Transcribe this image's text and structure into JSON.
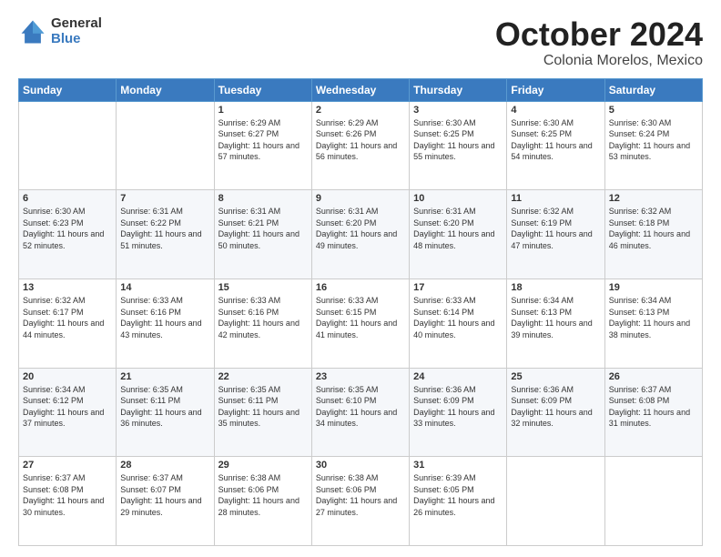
{
  "logo": {
    "general": "General",
    "blue": "Blue"
  },
  "title": {
    "month": "October 2024",
    "location": "Colonia Morelos, Mexico"
  },
  "weekdays": [
    "Sunday",
    "Monday",
    "Tuesday",
    "Wednesday",
    "Thursday",
    "Friday",
    "Saturday"
  ],
  "weeks": [
    [
      {
        "day": "",
        "sunrise": "",
        "sunset": "",
        "daylight": ""
      },
      {
        "day": "",
        "sunrise": "",
        "sunset": "",
        "daylight": ""
      },
      {
        "day": "1",
        "sunrise": "Sunrise: 6:29 AM",
        "sunset": "Sunset: 6:27 PM",
        "daylight": "Daylight: 11 hours and 57 minutes."
      },
      {
        "day": "2",
        "sunrise": "Sunrise: 6:29 AM",
        "sunset": "Sunset: 6:26 PM",
        "daylight": "Daylight: 11 hours and 56 minutes."
      },
      {
        "day": "3",
        "sunrise": "Sunrise: 6:30 AM",
        "sunset": "Sunset: 6:25 PM",
        "daylight": "Daylight: 11 hours and 55 minutes."
      },
      {
        "day": "4",
        "sunrise": "Sunrise: 6:30 AM",
        "sunset": "Sunset: 6:25 PM",
        "daylight": "Daylight: 11 hours and 54 minutes."
      },
      {
        "day": "5",
        "sunrise": "Sunrise: 6:30 AM",
        "sunset": "Sunset: 6:24 PM",
        "daylight": "Daylight: 11 hours and 53 minutes."
      }
    ],
    [
      {
        "day": "6",
        "sunrise": "Sunrise: 6:30 AM",
        "sunset": "Sunset: 6:23 PM",
        "daylight": "Daylight: 11 hours and 52 minutes."
      },
      {
        "day": "7",
        "sunrise": "Sunrise: 6:31 AM",
        "sunset": "Sunset: 6:22 PM",
        "daylight": "Daylight: 11 hours and 51 minutes."
      },
      {
        "day": "8",
        "sunrise": "Sunrise: 6:31 AM",
        "sunset": "Sunset: 6:21 PM",
        "daylight": "Daylight: 11 hours and 50 minutes."
      },
      {
        "day": "9",
        "sunrise": "Sunrise: 6:31 AM",
        "sunset": "Sunset: 6:20 PM",
        "daylight": "Daylight: 11 hours and 49 minutes."
      },
      {
        "day": "10",
        "sunrise": "Sunrise: 6:31 AM",
        "sunset": "Sunset: 6:20 PM",
        "daylight": "Daylight: 11 hours and 48 minutes."
      },
      {
        "day": "11",
        "sunrise": "Sunrise: 6:32 AM",
        "sunset": "Sunset: 6:19 PM",
        "daylight": "Daylight: 11 hours and 47 minutes."
      },
      {
        "day": "12",
        "sunrise": "Sunrise: 6:32 AM",
        "sunset": "Sunset: 6:18 PM",
        "daylight": "Daylight: 11 hours and 46 minutes."
      }
    ],
    [
      {
        "day": "13",
        "sunrise": "Sunrise: 6:32 AM",
        "sunset": "Sunset: 6:17 PM",
        "daylight": "Daylight: 11 hours and 44 minutes."
      },
      {
        "day": "14",
        "sunrise": "Sunrise: 6:33 AM",
        "sunset": "Sunset: 6:16 PM",
        "daylight": "Daylight: 11 hours and 43 minutes."
      },
      {
        "day": "15",
        "sunrise": "Sunrise: 6:33 AM",
        "sunset": "Sunset: 6:16 PM",
        "daylight": "Daylight: 11 hours and 42 minutes."
      },
      {
        "day": "16",
        "sunrise": "Sunrise: 6:33 AM",
        "sunset": "Sunset: 6:15 PM",
        "daylight": "Daylight: 11 hours and 41 minutes."
      },
      {
        "day": "17",
        "sunrise": "Sunrise: 6:33 AM",
        "sunset": "Sunset: 6:14 PM",
        "daylight": "Daylight: 11 hours and 40 minutes."
      },
      {
        "day": "18",
        "sunrise": "Sunrise: 6:34 AM",
        "sunset": "Sunset: 6:13 PM",
        "daylight": "Daylight: 11 hours and 39 minutes."
      },
      {
        "day": "19",
        "sunrise": "Sunrise: 6:34 AM",
        "sunset": "Sunset: 6:13 PM",
        "daylight": "Daylight: 11 hours and 38 minutes."
      }
    ],
    [
      {
        "day": "20",
        "sunrise": "Sunrise: 6:34 AM",
        "sunset": "Sunset: 6:12 PM",
        "daylight": "Daylight: 11 hours and 37 minutes."
      },
      {
        "day": "21",
        "sunrise": "Sunrise: 6:35 AM",
        "sunset": "Sunset: 6:11 PM",
        "daylight": "Daylight: 11 hours and 36 minutes."
      },
      {
        "day": "22",
        "sunrise": "Sunrise: 6:35 AM",
        "sunset": "Sunset: 6:11 PM",
        "daylight": "Daylight: 11 hours and 35 minutes."
      },
      {
        "day": "23",
        "sunrise": "Sunrise: 6:35 AM",
        "sunset": "Sunset: 6:10 PM",
        "daylight": "Daylight: 11 hours and 34 minutes."
      },
      {
        "day": "24",
        "sunrise": "Sunrise: 6:36 AM",
        "sunset": "Sunset: 6:09 PM",
        "daylight": "Daylight: 11 hours and 33 minutes."
      },
      {
        "day": "25",
        "sunrise": "Sunrise: 6:36 AM",
        "sunset": "Sunset: 6:09 PM",
        "daylight": "Daylight: 11 hours and 32 minutes."
      },
      {
        "day": "26",
        "sunrise": "Sunrise: 6:37 AM",
        "sunset": "Sunset: 6:08 PM",
        "daylight": "Daylight: 11 hours and 31 minutes."
      }
    ],
    [
      {
        "day": "27",
        "sunrise": "Sunrise: 6:37 AM",
        "sunset": "Sunset: 6:08 PM",
        "daylight": "Daylight: 11 hours and 30 minutes."
      },
      {
        "day": "28",
        "sunrise": "Sunrise: 6:37 AM",
        "sunset": "Sunset: 6:07 PM",
        "daylight": "Daylight: 11 hours and 29 minutes."
      },
      {
        "day": "29",
        "sunrise": "Sunrise: 6:38 AM",
        "sunset": "Sunset: 6:06 PM",
        "daylight": "Daylight: 11 hours and 28 minutes."
      },
      {
        "day": "30",
        "sunrise": "Sunrise: 6:38 AM",
        "sunset": "Sunset: 6:06 PM",
        "daylight": "Daylight: 11 hours and 27 minutes."
      },
      {
        "day": "31",
        "sunrise": "Sunrise: 6:39 AM",
        "sunset": "Sunset: 6:05 PM",
        "daylight": "Daylight: 11 hours and 26 minutes."
      },
      {
        "day": "",
        "sunrise": "",
        "sunset": "",
        "daylight": ""
      },
      {
        "day": "",
        "sunrise": "",
        "sunset": "",
        "daylight": ""
      }
    ]
  ]
}
